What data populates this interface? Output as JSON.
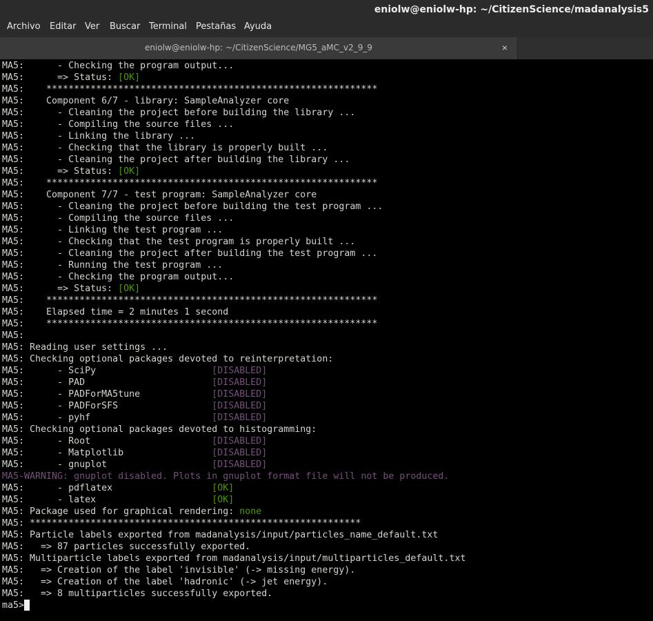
{
  "window": {
    "title": "eniolw@eniolw-hp: ~/CitizenScience/madanalysis5"
  },
  "menu": [
    "Archivo",
    "Editar",
    "Ver",
    "Buscar",
    "Terminal",
    "Pestañas",
    "Ayuda"
  ],
  "tab": {
    "title": "eniolw@eniolw-hp: ~/CitizenScience/MG5_aMC_v2_9_9",
    "close_glyph": "×"
  },
  "colors": {
    "ok": "#4e9a06",
    "disabled": "#75507b",
    "text": "#d3d7cf",
    "background": "#000000"
  },
  "terminal": {
    "lines": [
      [
        {
          "t": "MA5:      - Checking the program output..."
        }
      ],
      [
        {
          "t": "MA5:      => Status: "
        },
        {
          "t": "[OK]",
          "c": "ok"
        }
      ],
      [
        {
          "t": "MA5:    ************************************************************"
        }
      ],
      [
        {
          "t": "MA5:    Component 6/7 - library: SampleAnalyzer core"
        }
      ],
      [
        {
          "t": "MA5:      - Cleaning the project before building the library ..."
        }
      ],
      [
        {
          "t": "MA5:      - Compiling the source files ..."
        }
      ],
      [
        {
          "t": "MA5:      - Linking the library ..."
        }
      ],
      [
        {
          "t": "MA5:      - Checking that the library is properly built ..."
        }
      ],
      [
        {
          "t": "MA5:      - Cleaning the project after building the library ..."
        }
      ],
      [
        {
          "t": "MA5:      => Status: "
        },
        {
          "t": "[OK]",
          "c": "ok"
        }
      ],
      [
        {
          "t": "MA5:    ************************************************************"
        }
      ],
      [
        {
          "t": "MA5:    Component 7/7 - test program: SampleAnalyzer core"
        }
      ],
      [
        {
          "t": "MA5:      - Cleaning the project before building the test program ..."
        }
      ],
      [
        {
          "t": "MA5:      - Compiling the source files ..."
        }
      ],
      [
        {
          "t": "MA5:      - Linking the test program ..."
        }
      ],
      [
        {
          "t": "MA5:      - Checking that the test program is properly built ..."
        }
      ],
      [
        {
          "t": "MA5:      - Cleaning the project after building the test program ..."
        }
      ],
      [
        {
          "t": "MA5:      - Running the test program ..."
        }
      ],
      [
        {
          "t": "MA5:      - Checking the program output..."
        }
      ],
      [
        {
          "t": "MA5:      => Status: "
        },
        {
          "t": "[OK]",
          "c": "ok"
        }
      ],
      [
        {
          "t": "MA5:    ************************************************************"
        }
      ],
      [
        {
          "t": "MA5:    Elapsed time = 2 minutes 1 second"
        }
      ],
      [
        {
          "t": "MA5:    ************************************************************"
        }
      ],
      [
        {
          "t": "MA5:"
        }
      ],
      [
        {
          "t": "MA5: Reading user settings ..."
        }
      ],
      [
        {
          "t": "MA5: Checking optional packages devoted to reinterpretation:"
        }
      ],
      [
        {
          "t": "MA5:      - SciPy                     "
        },
        {
          "t": "[DISABLED]",
          "c": "dis"
        }
      ],
      [
        {
          "t": "MA5:      - PAD                       "
        },
        {
          "t": "[DISABLED]",
          "c": "dis"
        }
      ],
      [
        {
          "t": "MA5:      - PADForMA5tune             "
        },
        {
          "t": "[DISABLED]",
          "c": "dis"
        }
      ],
      [
        {
          "t": "MA5:      - PADForSFS                 "
        },
        {
          "t": "[DISABLED]",
          "c": "dis"
        }
      ],
      [
        {
          "t": "MA5:      - pyhf                      "
        },
        {
          "t": "[DISABLED]",
          "c": "dis"
        }
      ],
      [
        {
          "t": "MA5: Checking optional packages devoted to histogramming:"
        }
      ],
      [
        {
          "t": "MA5:      - Root                      "
        },
        {
          "t": "[DISABLED]",
          "c": "dis"
        }
      ],
      [
        {
          "t": "MA5:      - Matplotlib                "
        },
        {
          "t": "[DISABLED]",
          "c": "dis"
        }
      ],
      [
        {
          "t": "MA5:      - gnuplot                   "
        },
        {
          "t": "[DISABLED]",
          "c": "dis"
        }
      ],
      [
        {
          "t": "MA5-WARNING: gnuplot disabled. Plots in gnuplot format file will not be produced.",
          "c": "warn"
        }
      ],
      [
        {
          "t": "MA5:      - pdflatex                  "
        },
        {
          "t": "[OK]",
          "c": "ok"
        }
      ],
      [
        {
          "t": "MA5:      - latex                     "
        },
        {
          "t": "[OK]",
          "c": "ok"
        }
      ],
      [
        {
          "t": "MA5: Package used for graphical rendering: "
        },
        {
          "t": "none",
          "c": "ok"
        }
      ],
      [
        {
          "t": "MA5: ************************************************************"
        }
      ],
      [
        {
          "t": "MA5: Particle labels exported from madanalysis/input/particles_name_default.txt"
        }
      ],
      [
        {
          "t": "MA5:   => 87 particles successfully exported."
        }
      ],
      [
        {
          "t": "MA5: Multiparticle labels exported from madanalysis/input/multiparticles_default.txt"
        }
      ],
      [
        {
          "t": "MA5:   => Creation of the label 'invisible' (-> missing energy)."
        }
      ],
      [
        {
          "t": "MA5:   => Creation of the label 'hadronic' (-> jet energy)."
        }
      ],
      [
        {
          "t": "MA5:   => 8 multiparticles successfully exported."
        }
      ]
    ],
    "prompt": "ma5>"
  }
}
